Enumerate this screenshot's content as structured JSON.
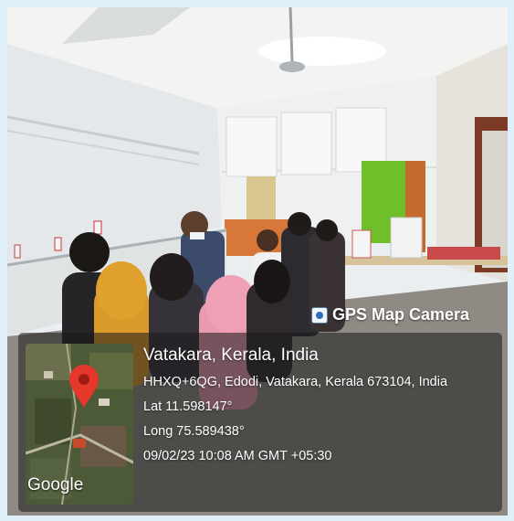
{
  "watermark": {
    "app_name": "GPS Map Camera",
    "location": "Vatakara, Kerala, India",
    "address": "HHXQ+6QG, Edodi, Vatakara, Kerala 673104, India",
    "latitude": "Lat 11.598147°",
    "longitude": "Long 75.589438°",
    "datetime": "09/02/23 10:08 AM GMT +05:30",
    "map_logo": "Google",
    "map_pin_icon": "location-pin-icon",
    "colors": {
      "pin": "#e5372a",
      "overlay": "#191919",
      "wall_green": "#6ebf2a"
    }
  }
}
